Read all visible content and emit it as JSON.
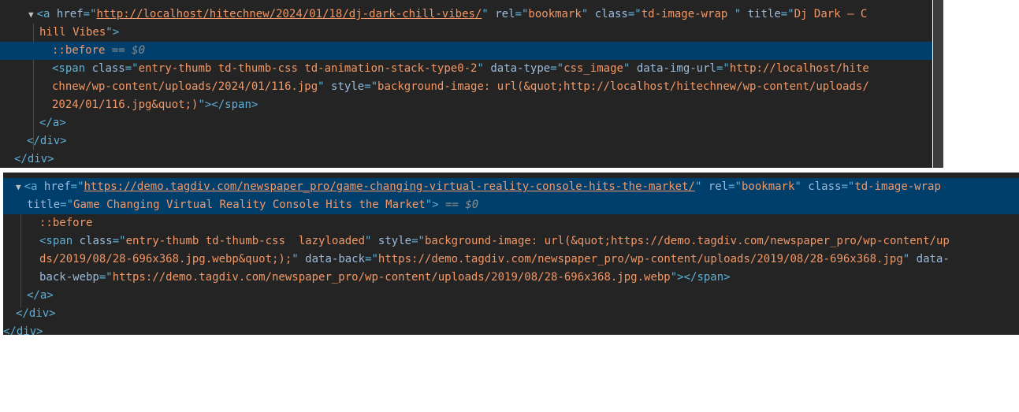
{
  "top": {
    "lines": [
      {
        "indent": 36,
        "parts": [
          {
            "t": "arrow",
            "v": "▼"
          },
          {
            "t": "tag",
            "v": "<a"
          },
          {
            "t": "plain",
            "v": " "
          },
          {
            "t": "attr",
            "v": "href"
          },
          {
            "t": "tag",
            "v": "=\""
          },
          {
            "t": "link",
            "v": "http://localhost/hitechnew/2024/01/18/dj-dark-chill-vibes/"
          },
          {
            "t": "tag",
            "v": "\""
          },
          {
            "t": "plain",
            "v": " "
          },
          {
            "t": "attr",
            "v": "rel"
          },
          {
            "t": "tag",
            "v": "=\""
          },
          {
            "t": "val",
            "v": "bookmark"
          },
          {
            "t": "tag",
            "v": "\""
          },
          {
            "t": "plain",
            "v": " "
          },
          {
            "t": "attr",
            "v": "class"
          },
          {
            "t": "tag",
            "v": "=\""
          },
          {
            "t": "val",
            "v": "td-image-wrap "
          },
          {
            "t": "tag",
            "v": "\""
          },
          {
            "t": "plain",
            "v": " "
          },
          {
            "t": "attr",
            "v": "title"
          },
          {
            "t": "tag",
            "v": "=\""
          },
          {
            "t": "val",
            "v": "Dj Dark – C"
          }
        ]
      },
      {
        "indent": 50,
        "parts": [
          {
            "t": "val",
            "v": "hill Vibes"
          },
          {
            "t": "tag",
            "v": "\">"
          }
        ]
      },
      {
        "indent": 66,
        "selected": true,
        "parts": [
          {
            "t": "pseudo",
            "v": "::before"
          },
          {
            "t": "eq",
            "v": " == "
          },
          {
            "t": "var",
            "v": "$0"
          }
        ]
      },
      {
        "indent": 66,
        "parts": [
          {
            "t": "tag",
            "v": "<span"
          },
          {
            "t": "plain",
            "v": " "
          },
          {
            "t": "attr",
            "v": "class"
          },
          {
            "t": "tag",
            "v": "=\""
          },
          {
            "t": "val",
            "v": "entry-thumb td-thumb-css td-animation-stack-type0-2"
          },
          {
            "t": "tag",
            "v": "\""
          },
          {
            "t": "plain",
            "v": " "
          },
          {
            "t": "attr",
            "v": "data-type"
          },
          {
            "t": "tag",
            "v": "=\""
          },
          {
            "t": "val",
            "v": "css_image"
          },
          {
            "t": "tag",
            "v": "\""
          },
          {
            "t": "plain",
            "v": " "
          },
          {
            "t": "attr",
            "v": "data-img-url"
          },
          {
            "t": "tag",
            "v": "=\""
          },
          {
            "t": "val",
            "v": "http://localhost/hite"
          }
        ]
      },
      {
        "indent": 66,
        "parts": [
          {
            "t": "val",
            "v": "chnew/wp-content/uploads/2024/01/116.jpg"
          },
          {
            "t": "tag",
            "v": "\""
          },
          {
            "t": "plain",
            "v": " "
          },
          {
            "t": "attr",
            "v": "style"
          },
          {
            "t": "tag",
            "v": "=\""
          },
          {
            "t": "val",
            "v": "background-image: url(&quot;http://localhost/hitechnew/wp-content/uploads/"
          }
        ]
      },
      {
        "indent": 66,
        "parts": [
          {
            "t": "val",
            "v": "2024/01/116.jpg&quot;)"
          },
          {
            "t": "tag",
            "v": "\"></span>"
          }
        ]
      },
      {
        "indent": 50,
        "parts": [
          {
            "t": "tag",
            "v": "</a>"
          }
        ]
      },
      {
        "indent": 34,
        "parts": [
          {
            "t": "tag",
            "v": "</div>"
          }
        ]
      },
      {
        "indent": 18,
        "parts": [
          {
            "t": "tag",
            "v": "</div>"
          }
        ]
      }
    ]
  },
  "bottom": {
    "lines": [
      {
        "indent": 16,
        "selected": true,
        "parts": [
          {
            "t": "arrow",
            "v": "▼"
          },
          {
            "t": "tag",
            "v": "<a"
          },
          {
            "t": "plain",
            "v": " "
          },
          {
            "t": "attr",
            "v": "href"
          },
          {
            "t": "tag",
            "v": "=\""
          },
          {
            "t": "link",
            "v": "https://demo.tagdiv.com/newspaper_pro/game-changing-virtual-reality-console-hits-the-market/"
          },
          {
            "t": "tag",
            "v": "\""
          },
          {
            "t": "plain",
            "v": " "
          },
          {
            "t": "attr",
            "v": "rel"
          },
          {
            "t": "tag",
            "v": "=\""
          },
          {
            "t": "val",
            "v": "bookmark"
          },
          {
            "t": "tag",
            "v": "\""
          },
          {
            "t": "plain",
            "v": " "
          },
          {
            "t": "attr",
            "v": "class"
          },
          {
            "t": "tag",
            "v": "=\""
          },
          {
            "t": "val",
            "v": "td-image-wrap"
          }
        ]
      },
      {
        "indent": 30,
        "selected": true,
        "parts": [
          {
            "t": "attr",
            "v": "title"
          },
          {
            "t": "tag",
            "v": "=\""
          },
          {
            "t": "val",
            "v": "Game Changing Virtual Reality Console Hits the Market"
          },
          {
            "t": "tag",
            "v": "\">"
          },
          {
            "t": "eq",
            "v": " == "
          },
          {
            "t": "var",
            "v": "$0"
          }
        ]
      },
      {
        "indent": 46,
        "parts": [
          {
            "t": "pseudo",
            "v": "::before"
          }
        ]
      },
      {
        "indent": 46,
        "parts": [
          {
            "t": "tag",
            "v": "<span"
          },
          {
            "t": "plain",
            "v": " "
          },
          {
            "t": "attr",
            "v": "class"
          },
          {
            "t": "tag",
            "v": "=\""
          },
          {
            "t": "val",
            "v": "entry-thumb td-thumb-css  lazyloaded"
          },
          {
            "t": "tag",
            "v": "\""
          },
          {
            "t": "plain",
            "v": " "
          },
          {
            "t": "attr",
            "v": "style"
          },
          {
            "t": "tag",
            "v": "=\""
          },
          {
            "t": "val",
            "v": "background-image: url(&quot;https://demo.tagdiv.com/newspaper_pro/wp-content/up"
          }
        ]
      },
      {
        "indent": 46,
        "parts": [
          {
            "t": "val",
            "v": "ds/2019/08/28-696x368.jpg.webp&quot;);"
          },
          {
            "t": "tag",
            "v": "\""
          },
          {
            "t": "plain",
            "v": " "
          },
          {
            "t": "attr",
            "v": "data-back"
          },
          {
            "t": "tag",
            "v": "=\""
          },
          {
            "t": "val",
            "v": "https://demo.tagdiv.com/newspaper_pro/wp-content/uploads/2019/08/28-696x368.jpg"
          },
          {
            "t": "tag",
            "v": "\""
          },
          {
            "t": "plain",
            "v": " "
          },
          {
            "t": "attr",
            "v": "data-"
          }
        ]
      },
      {
        "indent": 46,
        "parts": [
          {
            "t": "attr",
            "v": "back-webp"
          },
          {
            "t": "tag",
            "v": "=\""
          },
          {
            "t": "val",
            "v": "https://demo.tagdiv.com/newspaper_pro/wp-content/uploads/2019/08/28-696x368.jpg.webp"
          },
          {
            "t": "tag",
            "v": "\"></span>"
          }
        ]
      },
      {
        "indent": 30,
        "parts": [
          {
            "t": "tag",
            "v": "</a>"
          }
        ]
      },
      {
        "indent": 16,
        "parts": [
          {
            "t": "tag",
            "v": "</div>"
          }
        ]
      },
      {
        "indent": 0,
        "parts": [
          {
            "t": "tag",
            "v": "</div>"
          }
        ]
      }
    ]
  }
}
